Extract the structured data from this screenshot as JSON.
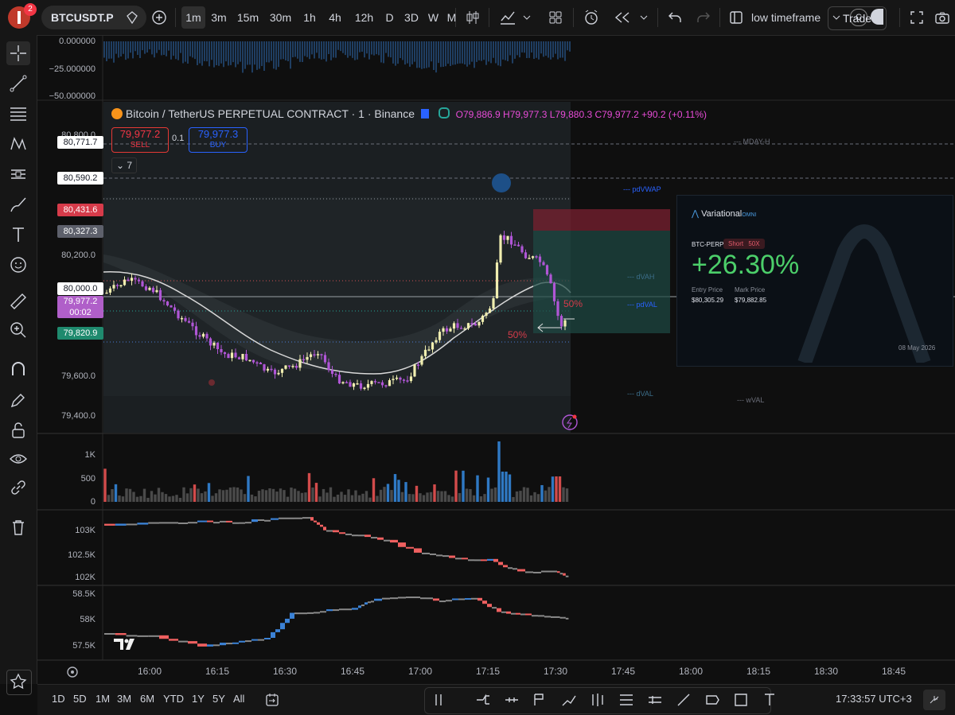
{
  "toolbar": {
    "notification_count": "2",
    "symbol": "BTCUSDT.P",
    "timeframes": [
      "1m",
      "3m",
      "15m",
      "30m",
      "1h",
      "4h",
      "12h",
      "D",
      "3D",
      "W",
      "M"
    ],
    "active_timeframe": "1m",
    "layout_name": "low timeframe",
    "trade_label": "Trade",
    "c_label": "C"
  },
  "legend": {
    "title": "Bitcoin / TetherUS PERPETUAL CONTRACT · 1 · Binance",
    "ohlc": "O79,886.9 H79,977.3 L79,880.3 C79,977.2 +90.2 (+0.11%)"
  },
  "order": {
    "sell_price": "79,977.2",
    "sell_label": "SELL",
    "spread": "0.1",
    "buy_price": "79,977.3",
    "buy_label": "BUY",
    "collapse_count": "7"
  },
  "indicator_axis": [
    "0.000000",
    "−25.000000",
    "−50.000000"
  ],
  "price_axis": [
    "80,800.0",
    "80,200.0",
    "80,000.0",
    "79,600.0",
    "79,400.0"
  ],
  "price_labels": {
    "hline1": "80,771.7",
    "hline2": "80,590.2",
    "red": "80,431.6",
    "grey": "80,327.3",
    "current": "79,977.2",
    "countdown": "00:02",
    "green": "79,820.9",
    "current_colors": {
      "current": "#b05fc9",
      "red": "#d63b4a",
      "green": "#1f8a6e",
      "grey": "#5d606b"
    }
  },
  "level_labels": {
    "mday_h": "--- MDAY-H",
    "pdvwap": "--- pdVWAP",
    "dvah": "--- dVAH",
    "pdval": "--- pdVAL",
    "dval": "--- dVAL",
    "wval": "--- wVAL",
    "pct_top": "50%",
    "pct_left": "50%"
  },
  "volume_axis": [
    "1K",
    "500",
    "0"
  ],
  "ind2_axis": [
    "103K",
    "102.5K",
    "102K"
  ],
  "ind3_axis": [
    "58.5K",
    "58K",
    "57.5K"
  ],
  "time_axis": [
    "16:00",
    "16:15",
    "16:30",
    "16:45",
    "17:00",
    "17:15",
    "17:30",
    "17:45",
    "18:00",
    "18:15",
    "18:30",
    "18:45"
  ],
  "widget": {
    "brand": "Variational",
    "brand_suffix": "OMNI",
    "pair": "BTC-PERP",
    "side": "Short",
    "leverage": "50X",
    "pnl": "+26.30%",
    "entry_label": "Entry Price",
    "entry_value": "$80,305.29",
    "mark_label": "Mark Price",
    "mark_value": "$79,882.85",
    "date": "08 May 2026"
  },
  "bottom": {
    "ranges": [
      "1D",
      "5D",
      "1M",
      "3M",
      "6M",
      "YTD",
      "1Y",
      "5Y",
      "All"
    ],
    "clock": "17:33:57 UTC+3"
  },
  "colors": {
    "up": "#f0eeb0",
    "down": "#b056d6",
    "accent": "#2962ff",
    "red": "#f23645",
    "green": "#26a69a",
    "pnl": "#4ccf6a"
  },
  "icons": [
    "crosshair-icon",
    "trend-line-icon",
    "fib-icon",
    "pattern-icon",
    "forecast-icon",
    "brush-icon",
    "text-icon",
    "emoji-icon",
    "ruler-icon",
    "zoom-icon",
    "magnet-icon",
    "lock-drawing-icon",
    "unlock-icon",
    "eye-icon",
    "link-icon",
    "trash-icon",
    "star-icon"
  ]
}
